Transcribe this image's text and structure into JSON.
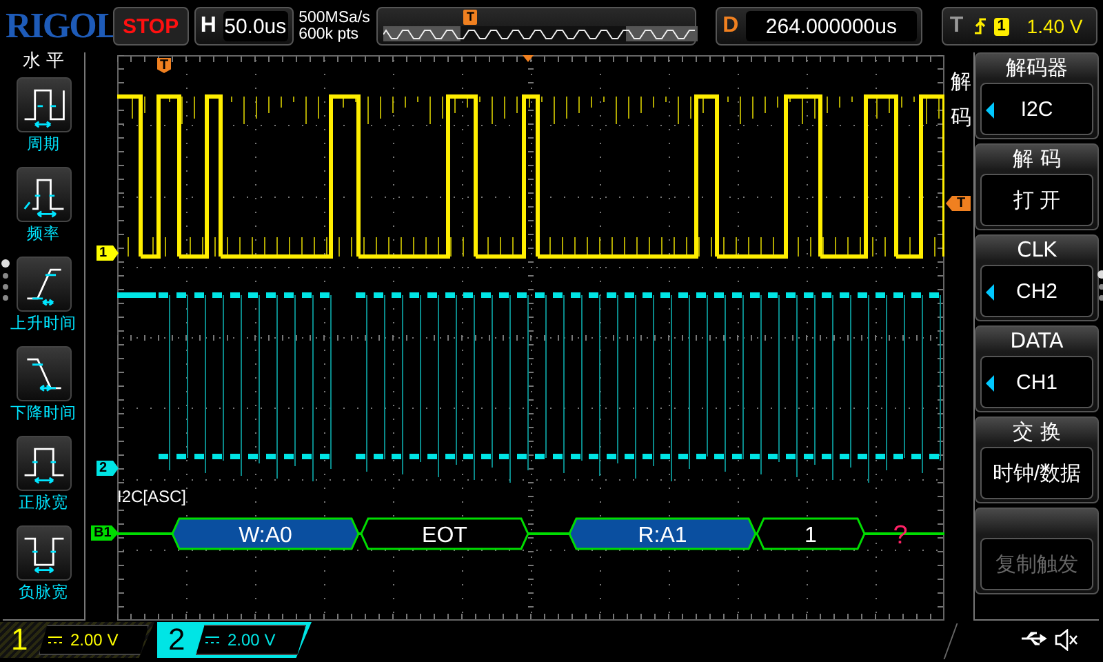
{
  "top_bar": {
    "logo": "RIGOL",
    "run_state": "STOP",
    "horizontal": {
      "label": "H",
      "timebase": "50.0us"
    },
    "sample_rate": "500MSa/s",
    "memory_depth": "600k pts",
    "trigger_position_marker": "T",
    "delay": {
      "label": "D",
      "value": "264.000000us"
    },
    "trigger": {
      "label": "T",
      "source": "1",
      "level": "1.40 V"
    }
  },
  "left_menu": {
    "title": "水 平",
    "items": [
      {
        "kind": "period",
        "label": "周期"
      },
      {
        "kind": "frequency",
        "label": "频率"
      },
      {
        "kind": "rise",
        "label": "上升时间"
      },
      {
        "kind": "fall",
        "label": "下降时间"
      },
      {
        "kind": "positive-width",
        "label": "正脉宽"
      },
      {
        "kind": "negative-width",
        "label": "负脉宽"
      }
    ],
    "page_dots": [
      {
        "selected": true
      },
      {
        "selected": false
      },
      {
        "selected": false
      },
      {
        "selected": false
      }
    ]
  },
  "scope": {
    "trigger_marker": "T",
    "trigger_level_marker": "T",
    "bus_label": "I2C[ASC]",
    "channel_markers": [
      {
        "label": "1",
        "color": "#ffff00"
      },
      {
        "label": "2",
        "color": "#00e5e5"
      },
      {
        "label": "B1",
        "color": "#00dd00"
      }
    ],
    "packets": [
      {
        "kind": "address",
        "text": "W:A0"
      },
      {
        "kind": "data",
        "text": "EOT"
      },
      {
        "kind": "address",
        "text": "R:A1"
      },
      {
        "kind": "data",
        "text": "1"
      },
      {
        "kind": "error",
        "text": "?"
      }
    ]
  },
  "right_menu": {
    "side_label": "解码",
    "items": [
      {
        "title": "解码器",
        "value": "I2C",
        "has_options": true,
        "disabled": false
      },
      {
        "title": "解 码",
        "value": "打 开",
        "has_options": false,
        "disabled": false
      },
      {
        "title": "CLK",
        "value": "CH2",
        "has_options": true,
        "disabled": false
      },
      {
        "title": "DATA",
        "value": "CH1",
        "has_options": true,
        "disabled": false
      },
      {
        "title": "交 换",
        "value": "时钟/数据",
        "has_options": false,
        "disabled": false
      },
      {
        "value": "复制触发",
        "has_options": false,
        "disabled": true
      }
    ],
    "page_dots": [
      {
        "selected": true
      },
      {
        "selected": false
      },
      {
        "selected": false
      }
    ]
  },
  "bottom_bar": {
    "channels": [
      {
        "number": "1",
        "scale": "2.00 V",
        "color": "#ffff00",
        "selected": false
      },
      {
        "number": "2",
        "scale": "2.00 V",
        "color": "#00e5e5",
        "selected": true
      }
    ]
  }
}
